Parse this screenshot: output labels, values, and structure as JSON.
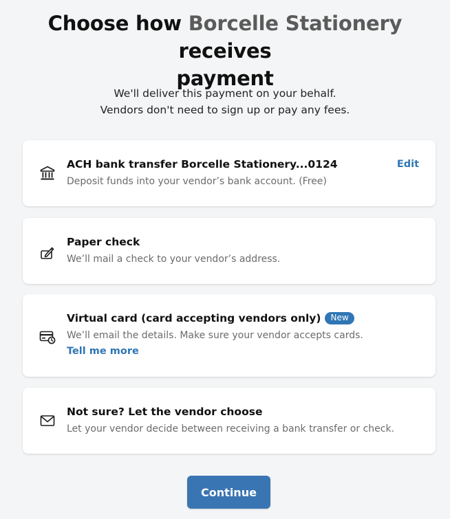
{
  "header": {
    "title_prefix": "Choose how ",
    "vendor_name": "Borcelle Stationery",
    "title_suffix_1": " receives",
    "title_line_2": "payment",
    "subtitle_line_1": "We'll deliver this payment on your behalf.",
    "subtitle_line_2": "Vendors don't need to sign up or pay any fees."
  },
  "options": [
    {
      "icon": "bank-icon",
      "title": "ACH bank transfer Borcelle Stationery...0124",
      "description": "Deposit funds into your vendor’s bank account. (Free)",
      "action_label": "Edit"
    },
    {
      "icon": "check-sign-icon",
      "title": "Paper check",
      "description": "We’ll mail a check to your vendor’s address."
    },
    {
      "icon": "virtual-card-icon",
      "title": "Virtual card (card accepting vendors only)",
      "badge": "New",
      "description": "We’ll email the details. Make sure your vendor accepts cards.",
      "link_label": "Tell me more"
    },
    {
      "icon": "envelope-icon",
      "title": "Not sure? Let the vendor choose",
      "description": "Let your vendor decide between receiving a bank transfer or check."
    }
  ],
  "footer": {
    "continue_label": "Continue"
  },
  "colors": {
    "accent": "#2f76b4",
    "button": "#3a75b3",
    "background": "#f4f5f6",
    "card": "#ffffff"
  }
}
